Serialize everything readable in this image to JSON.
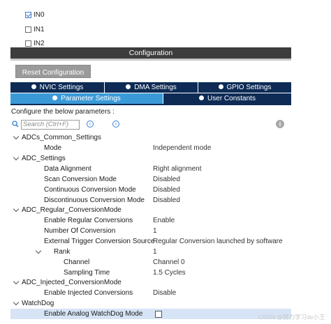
{
  "inputs": [
    {
      "label": "IN0",
      "checked": true
    },
    {
      "label": "IN1",
      "checked": false
    },
    {
      "label": "IN2",
      "checked": false
    }
  ],
  "panel": {
    "title": "Configuration",
    "reset_button": "Reset Configuration"
  },
  "tabs": {
    "row1": [
      "NVIC Settings",
      "DMA Settings",
      "GPIO Settings"
    ],
    "row2": [
      "Parameter Settings",
      "User Constants"
    ],
    "active": "Parameter Settings"
  },
  "hint": "Configure the below parameters :",
  "search": {
    "placeholder": "Search (Ctrl+F)"
  },
  "params": [
    {
      "label": "ADCs_Common_Settings",
      "value": "",
      "group": true
    },
    {
      "label": "Mode",
      "value": "Independent mode"
    },
    {
      "label": "ADC_Settings",
      "value": "",
      "group": true
    },
    {
      "label": "Data Alignment",
      "value": "Right alignment"
    },
    {
      "label": "Scan Conversion Mode",
      "value": "Disabled"
    },
    {
      "label": "Continuous Conversion Mode",
      "value": "Disabled"
    },
    {
      "label": "Discontinuous Conversion Mode",
      "value": "Disabled"
    },
    {
      "label": "ADC_Regular_ConversionMode",
      "value": "",
      "group": true
    },
    {
      "label": "Enable Regular Conversions",
      "value": "Enable"
    },
    {
      "label": "Number Of Conversion",
      "value": "1"
    },
    {
      "label": "External Trigger Conversion Source",
      "value": "Regular Conversion launched by software"
    },
    {
      "label": "Rank",
      "value": "1",
      "group": true
    },
    {
      "label": "Channel",
      "value": "Channel 0"
    },
    {
      "label": "Sampling Time",
      "value": "1.5 Cycles"
    },
    {
      "label": "ADC_Injected_ConversionMode",
      "value": "",
      "group": true
    },
    {
      "label": "Enable Injected Conversions",
      "value": "Disable"
    },
    {
      "label": "WatchDog",
      "value": "",
      "group": true
    },
    {
      "label": "Enable Analog WatchDog Mode",
      "value": "",
      "checkbox": false
    }
  ],
  "watermark": "CSDN @努力学习de小王",
  "colors": {
    "tab_dark": "#0d2b55",
    "tab_active": "#3a9ad8",
    "header_bar": "#3d3d3d",
    "selected_row": "#d6e4f5"
  }
}
